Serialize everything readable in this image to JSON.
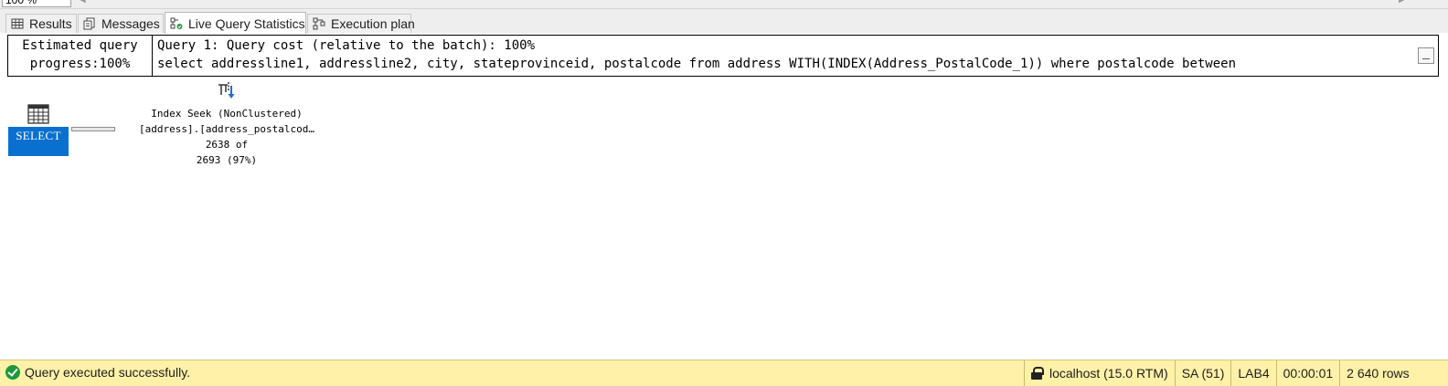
{
  "toolbar": {
    "zoom": "100 %"
  },
  "tabs": [
    {
      "label": "Results",
      "icon": "grid-icon",
      "active": false
    },
    {
      "label": "Messages",
      "icon": "messages-icon",
      "active": false
    },
    {
      "label": "Live Query Statistics",
      "icon": "live-stats-icon",
      "active": true
    },
    {
      "label": "Execution plan",
      "icon": "execution-plan-icon",
      "active": false
    }
  ],
  "query_header": {
    "progress_line1": "Estimated query",
    "progress_line2": "progress:100%",
    "cost_line": "Query 1: Query cost (relative to the batch): 100%",
    "sql_line": "select addressline1, addressline2, city, stateprovinceid, postalcode from address WITH(INDEX(Address_PostalCode_1)) where postalcode between"
  },
  "plan": {
    "select_label": "SELECT",
    "operator_name": "Index Seek (NonClustered)",
    "operator_object": "[address].[address_postalcod…",
    "rows_line1": "2638 of",
    "rows_line2": "2693 (97%)",
    "progress_percent": 97
  },
  "status": {
    "message": "Query executed successfully.",
    "server": "localhost (15.0 RTM)",
    "user": "SA (51)",
    "database": "LAB4",
    "elapsed": "00:00:01",
    "rows": "2 640 rows",
    "colors": {
      "bar": "#fff1a8",
      "ok": "#1c9a3c",
      "select": "#0a70cf"
    }
  }
}
